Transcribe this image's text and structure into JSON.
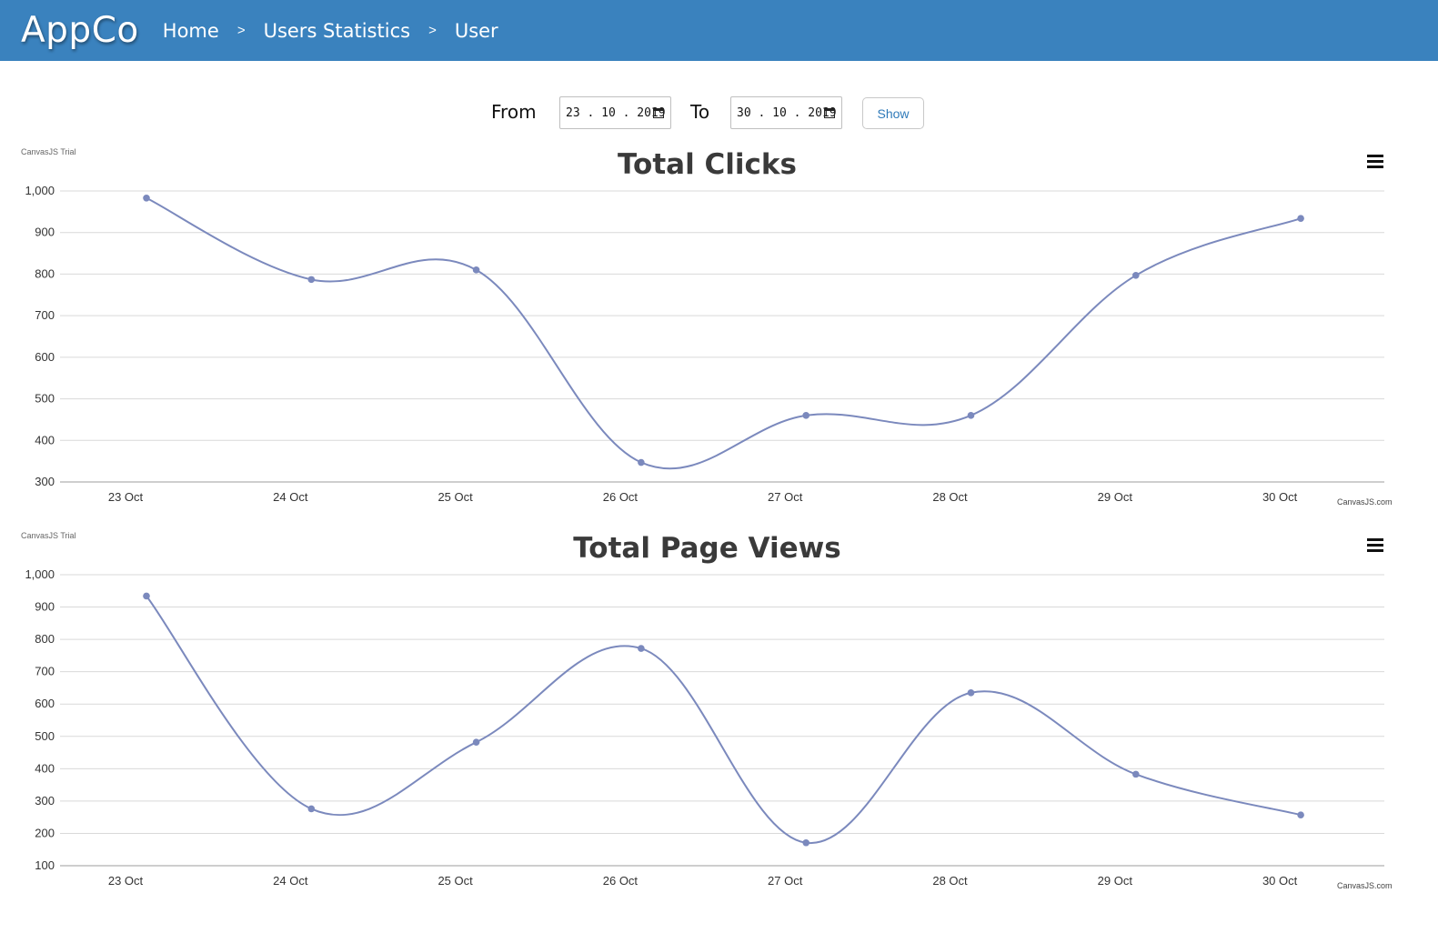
{
  "header": {
    "brand": "AppCo",
    "breadcrumbs": [
      "Home",
      "Users Statistics",
      "User"
    ],
    "separator": ">"
  },
  "filter": {
    "from_label": "From",
    "from_value": "23 . 10 . 2019",
    "to_label": "To",
    "to_value": "30 . 10 . 2019",
    "show_label": "Show"
  },
  "colors": {
    "header_bg": "#3a82be",
    "line": "#7b89bd",
    "grid": "#d9d9d9"
  },
  "chart_watermark": "CanvasJS Trial",
  "chart_credit": "CanvasJS.com",
  "chart_data": [
    {
      "type": "line",
      "title": "Total Clicks",
      "categories": [
        "23 Oct",
        "24 Oct",
        "25 Oct",
        "26 Oct",
        "27 Oct",
        "28 Oct",
        "29 Oct",
        "30 Oct"
      ],
      "x": [
        "2019-10-23",
        "2019-10-24",
        "2019-10-25",
        "2019-10-26",
        "2019-10-27",
        "2019-10-28",
        "2019-10-29",
        "2019-10-30"
      ],
      "series": [
        {
          "values": [
            983,
            787,
            810,
            347,
            460,
            460,
            797,
            934
          ]
        }
      ],
      "yticks": [
        "1,000",
        "900",
        "800",
        "700",
        "600",
        "500",
        "400",
        "300"
      ],
      "ylim": [
        300,
        1000
      ],
      "grid": true,
      "smooth": true
    },
    {
      "type": "line",
      "title": "Total Page Views",
      "categories": [
        "23 Oct",
        "24 Oct",
        "25 Oct",
        "26 Oct",
        "27 Oct",
        "28 Oct",
        "29 Oct",
        "30 Oct"
      ],
      "x": [
        "2019-10-23",
        "2019-10-24",
        "2019-10-25",
        "2019-10-26",
        "2019-10-27",
        "2019-10-28",
        "2019-10-29",
        "2019-10-30"
      ],
      "series": [
        {
          "values": [
            934,
            276,
            482,
            772,
            171,
            635,
            383,
            257
          ]
        }
      ],
      "yticks": [
        "1,000",
        "900",
        "800",
        "700",
        "600",
        "500",
        "400",
        "300",
        "200",
        "100"
      ],
      "ylim": [
        100,
        1000
      ],
      "grid": true,
      "smooth": true
    }
  ]
}
